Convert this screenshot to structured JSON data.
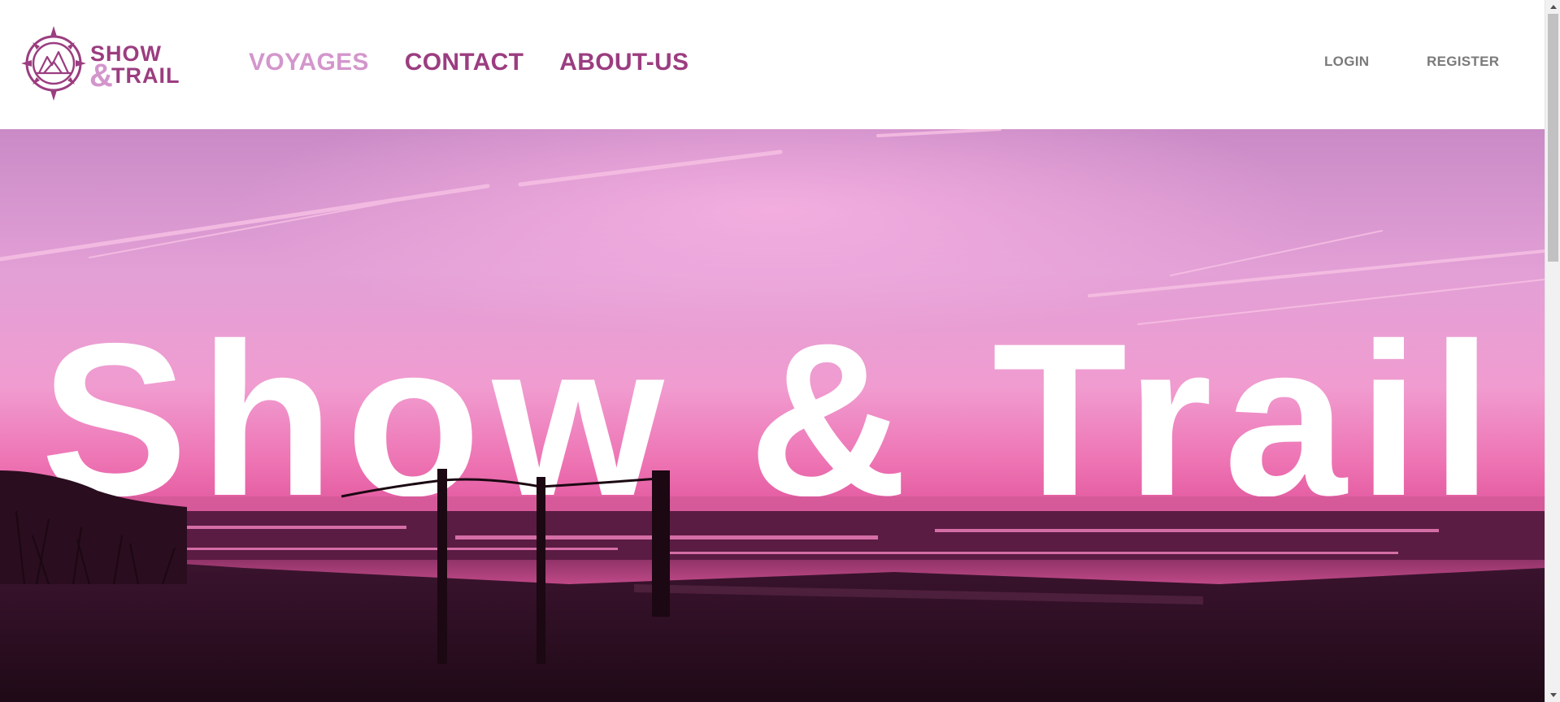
{
  "brand": {
    "logo_line1": "SHOW",
    "logo_amp": "&",
    "logo_line2": "TRAIL",
    "colors": {
      "primary": "#9b3d80",
      "light": "#d396cc"
    }
  },
  "nav": {
    "items": [
      {
        "label": "VOYAGES",
        "active": true
      },
      {
        "label": "CONTACT",
        "active": false
      },
      {
        "label": "ABOUT-US",
        "active": false
      }
    ]
  },
  "auth": {
    "login_label": "LOGIN",
    "register_label": "REGISTER"
  },
  "hero": {
    "headline": "Show & Trail"
  },
  "icons": {
    "logo": "compass-mountain-logo-icon",
    "scroll_up": "scroll-up-arrow-icon",
    "scroll_down": "scroll-down-arrow-icon"
  }
}
